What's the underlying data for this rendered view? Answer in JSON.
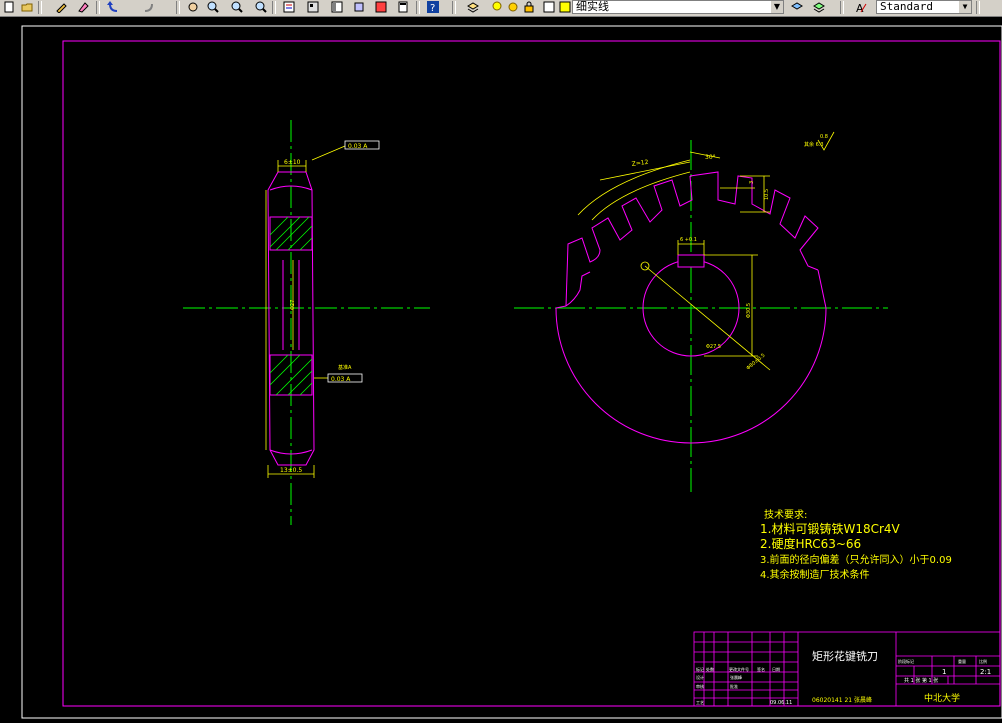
{
  "toolbar": {
    "layer_name": "细实线",
    "text_style": "Standard",
    "icons": [
      "new-icon",
      "open-icon",
      "pencil-icon",
      "eraser-icon",
      "undo-icon",
      "redo-icon",
      "pan-icon",
      "zoom-realtime-icon",
      "zoom-window-icon",
      "zoom-previous-icon",
      "properties-icon",
      "design-center-icon",
      "tool-palette-icon",
      "sheet-set-icon",
      "markup-icon",
      "calculator-icon",
      "help-icon",
      "layer-icon",
      "bulb-icon",
      "sun-icon",
      "lock-icon",
      "color-square-icon",
      "layer-states-icon",
      "layer-previous-icon",
      "text-style-icon"
    ]
  },
  "drawing": {
    "colors": {
      "border": "#ff00ff",
      "centerline": "#00ff00",
      "dimension": "#ffff00",
      "geometry": "#ff00ff",
      "text": "#ffff00"
    },
    "side_view": {
      "top_width_dim": "6±10",
      "bottom_width_dim": "13±0.5",
      "tolerance_top": "0.03 A",
      "tolerance_bottom": "0.03 A",
      "datum_label": "基准A",
      "bore_dim": "Φ27"
    },
    "front_view": {
      "teeth_label": "Z=12",
      "angle_label": "30°",
      "tooth_height": "3",
      "tooth_depth": "10.5",
      "keyway_width": "6 +0.1",
      "bore_label": "Φ27.5",
      "keyway_depth": "Φ30.5",
      "outer_dia": "Φ80±0.5",
      "surface_finish": "0.8",
      "other_finish": "其余 6.3"
    },
    "tech_requirements": {
      "title": "技术要求:",
      "items": [
        "1.材料可锻铸铁W18Cr4V",
        "2.硬度HRC63~66",
        "3.前面的径向偏差（只允许同入）小于0.09",
        "4.其余按制造厂技术条件"
      ]
    },
    "title_block": {
      "part_name": "矩形花键铣刀",
      "drawing_no": "06020141 21 张晨峰",
      "school": "中北大学",
      "scale": "2:1",
      "quantity": "1",
      "sheet_info": "共 1 张   第 1 张",
      "header_cells": [
        "标记",
        "处数",
        "更改文件号",
        "签名",
        "日期"
      ],
      "side_cells": [
        "阶段标记",
        "重量",
        "比例"
      ],
      "left_rows": [
        "设计",
        "审核",
        "工艺"
      ],
      "left_names": [
        "张晨峰",
        "批准"
      ],
      "date": "09.06.11"
    }
  }
}
